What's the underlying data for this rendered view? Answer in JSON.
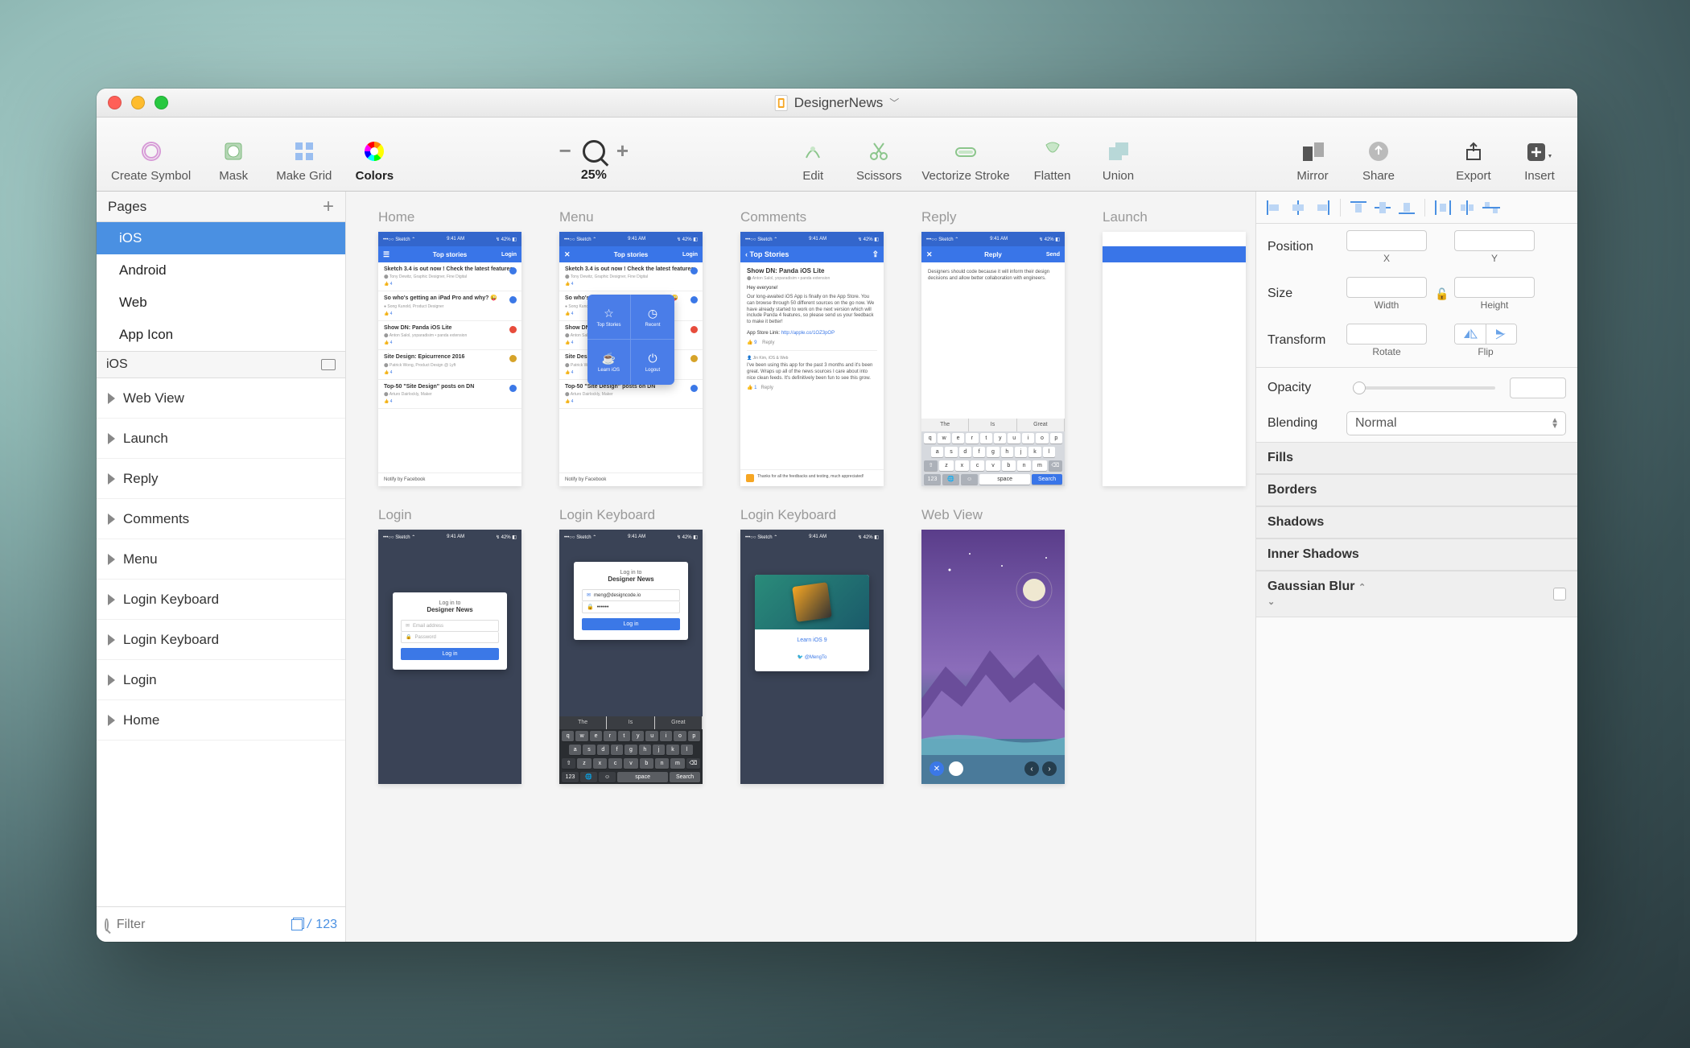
{
  "window": {
    "title": "DesignerNews"
  },
  "toolbar": {
    "items_left": [
      "Create Symbol",
      "Mask",
      "Make Grid",
      "Colors"
    ],
    "zoom": "25%",
    "items_mid": [
      "Edit",
      "Scissors",
      "Vectorize Stroke",
      "Flatten",
      "Union"
    ],
    "items_right": [
      "Mirror",
      "Share"
    ],
    "items_far": [
      "Export",
      "Insert"
    ]
  },
  "left": {
    "pages_header": "Pages",
    "pages": [
      "iOS",
      "Android",
      "Web",
      "App Icon"
    ],
    "selected_page_index": 0,
    "section": "iOS",
    "layers": [
      "Web View",
      "Launch",
      "Reply",
      "Comments",
      "Menu",
      "Login Keyboard",
      "Login Keyboard",
      "Login",
      "Home"
    ],
    "filter_placeholder": "Filter",
    "filter_count": "123"
  },
  "canvas": {
    "row1_labels": [
      "Home",
      "Menu",
      "Comments",
      "Reply",
      "Launch"
    ],
    "row2_labels": [
      "Login",
      "Login Keyboard",
      "Login Keyboard",
      "Web View"
    ],
    "phone_status": {
      "left": "•••○○ Sketch ⌃",
      "time": "9:41 AM",
      "right": "↯ 42% ◧"
    },
    "home": {
      "nav": {
        "menu": "☰",
        "title": "Top stories",
        "right": "Login"
      },
      "stories": [
        {
          "title": "Sketch 3.4 is out now ! Check the latest features",
          "sub": "⬤ Tony Dewitz, Graphic Designer, Fine Digital",
          "color": "#3b78e7"
        },
        {
          "title": "So who's getting an iPad Pro and why? 😜",
          "sub": "● Song Kunold, Product Designer",
          "color": "#3b78e7"
        },
        {
          "title": "Show DN: Panda iOS Lite",
          "sub": "⬤ Anton Salol, yoparadisim • panda extension",
          "color": "#e74c3c"
        },
        {
          "title": "Site Design: Epicurrence 2016",
          "sub": "⬤ Patrick Wong, Product Design @ Lyft",
          "color": "#d6a329"
        },
        {
          "title": "Top-50 \"Site Design\" posts on DN",
          "sub": "⬤ Arturo Dairlockly, Maker",
          "color": "#3b78e7"
        }
      ],
      "footer": "Notify by Facebook"
    },
    "menu": {
      "overlay_items": [
        "Top Stories",
        "Recent",
        "Learn iOS",
        "Logout"
      ]
    },
    "comments": {
      "nav_back": "Top Stories",
      "title": "Show DN: Panda iOS Lite",
      "byline": "⬤ Anton Salol, yoparadisim • panda extension",
      "greeting": "Hey everyone!",
      "body": "Our long-awaited iOS App is finally on the App Store. You can browse through 50 different sources on the go now. We have already started to work on the next version which will include Panda 4 features, so please send us your feedback to make it better!",
      "link_label": "App Store Link:",
      "link": "http://apple.co/1OZ3pOP",
      "like_count": "9",
      "reply_author": "Jin Kim, iOS & Web",
      "reply_body": "I've been using this app for the past 3 months and it's been great. Wraps up all of the news sources I care about into nice clean feeds. It's definitively been fun to see this grow.",
      "reply_likes": "1",
      "reply_action": "Reply",
      "footer_thanks": "Thanks for all the feedbacks and testing, much appreciated!"
    },
    "reply": {
      "nav_cancel": "✕",
      "nav_title": "Reply",
      "nav_send": "Send",
      "body": "Designers should code because it will inform their design decisions and allow better collaboration with engineers.",
      "suggestions": [
        "The",
        "Is",
        "Great"
      ]
    },
    "login": {
      "title1": "Log in to",
      "title2": "Designer News",
      "email_ph": "Email address",
      "pass_ph": "Password",
      "button": "Log in"
    },
    "login_kbd": {
      "email_value": "meng@designcode.io",
      "pass_value": "••••••",
      "suggestions": [
        "The",
        "Is",
        "Great"
      ]
    },
    "login_kbd2": {
      "learn": "Learn iOS 9",
      "twitter": "@MengTo"
    },
    "keyboard": {
      "r1": [
        "q",
        "w",
        "e",
        "r",
        "t",
        "y",
        "u",
        "i",
        "o",
        "p"
      ],
      "r2": [
        "a",
        "s",
        "d",
        "f",
        "g",
        "h",
        "j",
        "k",
        "l"
      ],
      "r3": [
        "⇧",
        "z",
        "x",
        "c",
        "v",
        "b",
        "n",
        "m",
        "⌫"
      ],
      "r4": [
        "123",
        "🌐",
        "☺",
        "space",
        "Search"
      ]
    }
  },
  "right": {
    "position": "Position",
    "x": "X",
    "y": "Y",
    "size": "Size",
    "width": "Width",
    "height": "Height",
    "transform": "Transform",
    "rotate": "Rotate",
    "flip": "Flip",
    "opacity": "Opacity",
    "blending": "Blending",
    "blending_value": "Normal",
    "sections": [
      "Fills",
      "Borders",
      "Shadows",
      "Inner Shadows"
    ],
    "blur": "Gaussian Blur"
  }
}
